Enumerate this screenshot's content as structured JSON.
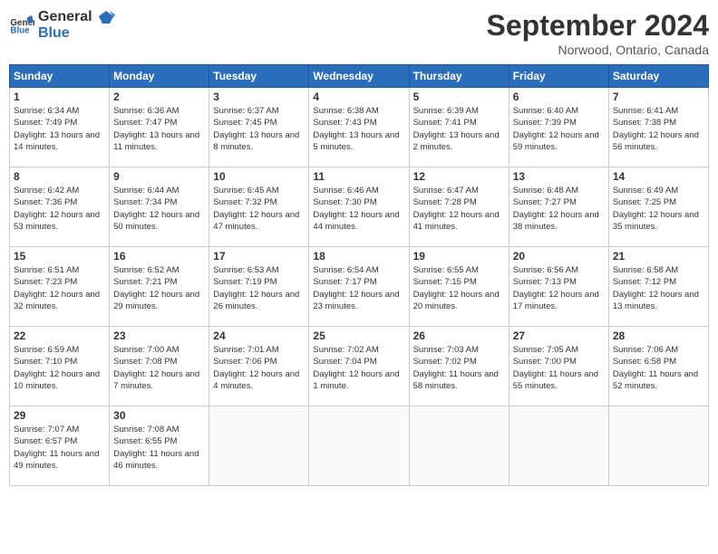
{
  "logo": {
    "general": "General",
    "blue": "Blue"
  },
  "title": "September 2024",
  "location": "Norwood, Ontario, Canada",
  "days_header": [
    "Sunday",
    "Monday",
    "Tuesday",
    "Wednesday",
    "Thursday",
    "Friday",
    "Saturday"
  ],
  "weeks": [
    [
      {
        "day": "1",
        "sunrise": "6:34 AM",
        "sunset": "7:49 PM",
        "daylight": "13 hours and 14 minutes."
      },
      {
        "day": "2",
        "sunrise": "6:36 AM",
        "sunset": "7:47 PM",
        "daylight": "13 hours and 11 minutes."
      },
      {
        "day": "3",
        "sunrise": "6:37 AM",
        "sunset": "7:45 PM",
        "daylight": "13 hours and 8 minutes."
      },
      {
        "day": "4",
        "sunrise": "6:38 AM",
        "sunset": "7:43 PM",
        "daylight": "13 hours and 5 minutes."
      },
      {
        "day": "5",
        "sunrise": "6:39 AM",
        "sunset": "7:41 PM",
        "daylight": "13 hours and 2 minutes."
      },
      {
        "day": "6",
        "sunrise": "6:40 AM",
        "sunset": "7:39 PM",
        "daylight": "12 hours and 59 minutes."
      },
      {
        "day": "7",
        "sunrise": "6:41 AM",
        "sunset": "7:38 PM",
        "daylight": "12 hours and 56 minutes."
      }
    ],
    [
      {
        "day": "8",
        "sunrise": "6:42 AM",
        "sunset": "7:36 PM",
        "daylight": "12 hours and 53 minutes."
      },
      {
        "day": "9",
        "sunrise": "6:44 AM",
        "sunset": "7:34 PM",
        "daylight": "12 hours and 50 minutes."
      },
      {
        "day": "10",
        "sunrise": "6:45 AM",
        "sunset": "7:32 PM",
        "daylight": "12 hours and 47 minutes."
      },
      {
        "day": "11",
        "sunrise": "6:46 AM",
        "sunset": "7:30 PM",
        "daylight": "12 hours and 44 minutes."
      },
      {
        "day": "12",
        "sunrise": "6:47 AM",
        "sunset": "7:28 PM",
        "daylight": "12 hours and 41 minutes."
      },
      {
        "day": "13",
        "sunrise": "6:48 AM",
        "sunset": "7:27 PM",
        "daylight": "12 hours and 38 minutes."
      },
      {
        "day": "14",
        "sunrise": "6:49 AM",
        "sunset": "7:25 PM",
        "daylight": "12 hours and 35 minutes."
      }
    ],
    [
      {
        "day": "15",
        "sunrise": "6:51 AM",
        "sunset": "7:23 PM",
        "daylight": "12 hours and 32 minutes."
      },
      {
        "day": "16",
        "sunrise": "6:52 AM",
        "sunset": "7:21 PM",
        "daylight": "12 hours and 29 minutes."
      },
      {
        "day": "17",
        "sunrise": "6:53 AM",
        "sunset": "7:19 PM",
        "daylight": "12 hours and 26 minutes."
      },
      {
        "day": "18",
        "sunrise": "6:54 AM",
        "sunset": "7:17 PM",
        "daylight": "12 hours and 23 minutes."
      },
      {
        "day": "19",
        "sunrise": "6:55 AM",
        "sunset": "7:15 PM",
        "daylight": "12 hours and 20 minutes."
      },
      {
        "day": "20",
        "sunrise": "6:56 AM",
        "sunset": "7:13 PM",
        "daylight": "12 hours and 17 minutes."
      },
      {
        "day": "21",
        "sunrise": "6:58 AM",
        "sunset": "7:12 PM",
        "daylight": "12 hours and 13 minutes."
      }
    ],
    [
      {
        "day": "22",
        "sunrise": "6:59 AM",
        "sunset": "7:10 PM",
        "daylight": "12 hours and 10 minutes."
      },
      {
        "day": "23",
        "sunrise": "7:00 AM",
        "sunset": "7:08 PM",
        "daylight": "12 hours and 7 minutes."
      },
      {
        "day": "24",
        "sunrise": "7:01 AM",
        "sunset": "7:06 PM",
        "daylight": "12 hours and 4 minutes."
      },
      {
        "day": "25",
        "sunrise": "7:02 AM",
        "sunset": "7:04 PM",
        "daylight": "12 hours and 1 minute."
      },
      {
        "day": "26",
        "sunrise": "7:03 AM",
        "sunset": "7:02 PM",
        "daylight": "11 hours and 58 minutes."
      },
      {
        "day": "27",
        "sunrise": "7:05 AM",
        "sunset": "7:00 PM",
        "daylight": "11 hours and 55 minutes."
      },
      {
        "day": "28",
        "sunrise": "7:06 AM",
        "sunset": "6:58 PM",
        "daylight": "11 hours and 52 minutes."
      }
    ],
    [
      {
        "day": "29",
        "sunrise": "7:07 AM",
        "sunset": "6:57 PM",
        "daylight": "11 hours and 49 minutes."
      },
      {
        "day": "30",
        "sunrise": "7:08 AM",
        "sunset": "6:55 PM",
        "daylight": "11 hours and 46 minutes."
      },
      null,
      null,
      null,
      null,
      null
    ]
  ]
}
